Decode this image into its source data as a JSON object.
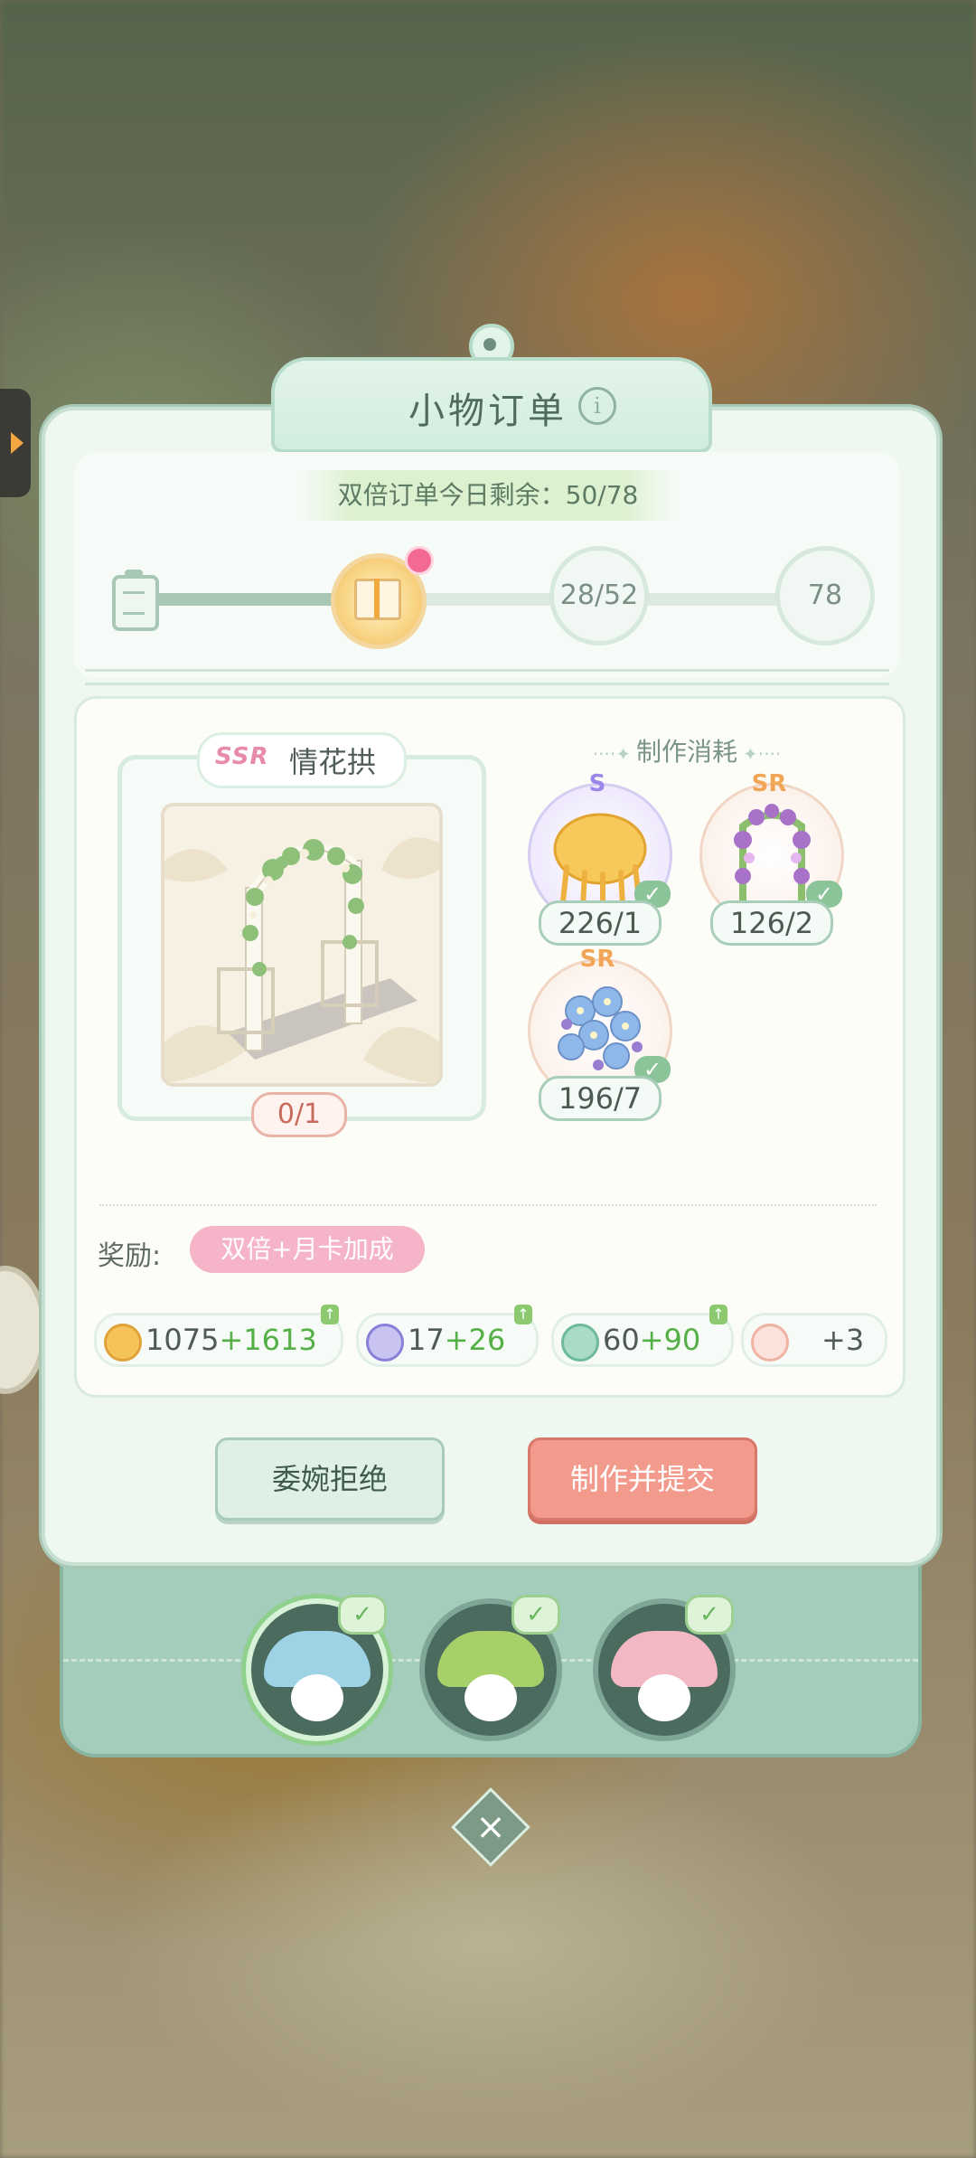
{
  "title": "小物订单",
  "info_icon": "i",
  "double_banner": "双倍订单今日剩余：50/78",
  "progress": {
    "fraction": 0.28,
    "milestones": [
      "28/52",
      "78"
    ]
  },
  "item": {
    "rarity": "SSR",
    "name": "情花拱",
    "count": "0/1"
  },
  "cost_header": "制作消耗",
  "materials": [
    {
      "rarity": "S",
      "qty": "226/1",
      "icon": "golden-jellyfish-icon"
    },
    {
      "rarity": "SR",
      "qty": "126/2",
      "icon": "purple-flower-vine-icon"
    },
    {
      "rarity": "SR",
      "qty": "196/7",
      "icon": "blue-flower-bouquet-icon"
    }
  ],
  "reward_label": "奖励:",
  "reward_tag": "双倍+月卡加成",
  "rewards": [
    {
      "base": "1075",
      "bonus": "+1613",
      "icon": "coin-house-icon"
    },
    {
      "base": "17",
      "bonus": "+26",
      "icon": "blue-gem-icon"
    },
    {
      "base": "60",
      "bonus": "+90",
      "icon": "exp-icon"
    },
    {
      "base": "",
      "bonus": "+3",
      "icon": "misc-reward-icon"
    }
  ],
  "buttons": {
    "decline": "委婉拒绝",
    "submit": "制作并提交"
  },
  "colors": {
    "accent_green": "#8cc49a",
    "submit_red": "#f29a8b",
    "bonus_green": "#54b046",
    "ssr_pink": "#e88aaa"
  }
}
